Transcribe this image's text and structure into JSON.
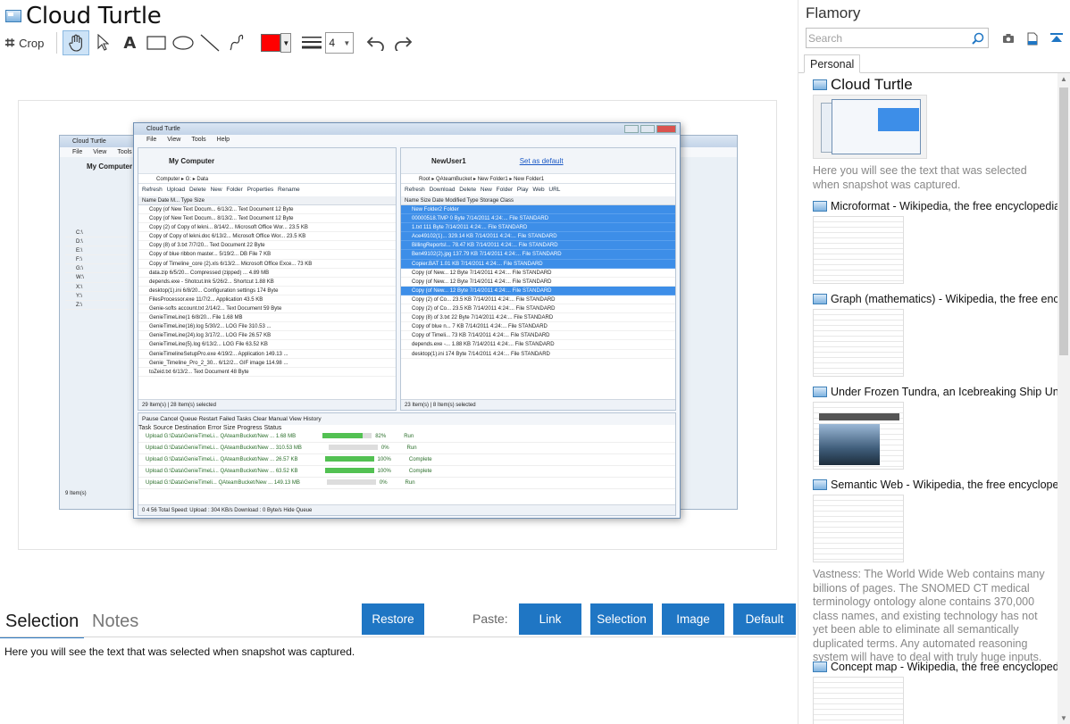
{
  "app": {
    "doc_title": "Cloud Turtle"
  },
  "toolbar": {
    "crop_label": "Crop",
    "color": "#ff0000",
    "line_width": "4"
  },
  "snapshot": {
    "window_title": "Cloud Turtle",
    "menu": [
      "File",
      "View",
      "Tools",
      "Help"
    ],
    "back_menu": [
      "File",
      "View",
      "Tools"
    ],
    "left_header": "My Computer",
    "left_path": "Computer ▸ G: ▸ Data",
    "left_actions": "Refresh Upload Delete New Folder Properties Rename",
    "left_cols": "Name   Date M...   Type   Size",
    "left_rows": [
      "Copy (of New Text Docum...   6/13/2...   Text Document   12 Byte",
      "Copy (of New Text Docum...   8/13/2...   Text Document   12 Byte",
      "Copy (2) of Copy of lekni...   8/14/2...   Microsoft Office Wor...   23.5 KB",
      "Copy of Copy of lekni.doc   6/13/2...   Microsoft Office Wor...   23.5 KB",
      "Copy (8) of 3.txt   7/7/20...   Text Document   22 Byte",
      "Copy of blue ribbon master...   5/19/2...   DB File   7 KB",
      "Copy of Timeline_core (2).xls   6/13/2...   Microsoft Office Exce...   73 KB",
      "data.zip   6/5/20...   Compressed (zipped) ...   4.89 MB",
      "depends.exe - Shotcut.lnk   5/26/2...   Shortcut   1.88 KB",
      "desktop(1).ini   6/8/20...   Configuration settings   174 Byte",
      "FilesProcessor.exe   11/7/2...   Application   43.5 KB",
      "Genie-softs account.txt   2/14/2...   Text Document   59 Byte",
      "GenieTimeLine(1   6/8/20...   File   1.68 MB",
      "GenieTimeLine(16).log   5/30/2...   LOG File   310.53 ...",
      "GenieTimeLine(24).log   3/17/2...   LOG File   26.57 KB",
      "GenieTimeLine(5).log   6/13/2...   LOG File   63.52 KB",
      "GenieTimelineSetupPro.exe   4/19/2...   Application   149.13 ...",
      "Genie_Timeline_Pro_2_30...   6/12/2...   GIF image   114.98 ...",
      "toZeid.txt   6/13/2...   Text Document   48 Byte"
    ],
    "left_status": "29 Item(s)  |  28 Item(s) selected",
    "right_header": "NewUser1",
    "right_setdefault": "Set as default",
    "right_path": "Root ▸ QAteamBucket ▸ New Folder1 ▸ New Folder1",
    "right_actions": "Refresh Download Delete New Folder Play Web URL",
    "right_cols": "Name   Size   Date Modified   Type   Storage Class",
    "right_rows": [
      "New Folder2                                                         Folder",
      "00000518.TMP   0 Byte   7/14/2011 4:24:...   File   STANDARD",
      "1.txt   111 Byte   7/14/2011 4:24:...   File   STANDARD",
      "Ace49102(1)...   329.14 KB   7/14/2011 4:24:...   File   STANDARD",
      "BillingReportsI...   78.47 KB   7/14/2011 4:24:...   File   STANDARD",
      "Ben49102(2).jpg   137.79 KB   7/14/2011 4:24:...   File   STANDARD",
      "Copier.BAT   1.01 KB   7/14/2011 4:24:...   File   STANDARD",
      "Copy (of New...   12 Byte   7/14/2011 4:24:...   File   STANDARD",
      "Copy (of New...   12 Byte   7/14/2011 4:24:...   File   STANDARD",
      "Copy (of New...   12 Byte   7/14/2011 4:24:...   File   STANDARD",
      "Copy (2) of Co...   23.5 KB   7/14/2011 4:24:...   File   STANDARD",
      "Copy (2) of Co...   23.5 KB   7/14/2011 4:24:...   File   STANDARD",
      "Copy (8) of 3.txt   22 Byte   7/14/2011 4:24:...   File   STANDARD",
      "Copy of blue n...   7 KB   7/14/2011 4:24:...   File   STANDARD",
      "Copy of Timeli...   73 KB   7/14/2011 4:24:...   File   STANDARD",
      "depends.exe -...   1.88 KB   7/14/2011 4:24:...   File   STANDARD",
      "desktop(1).ini   174 Byte   7/14/2011 4:24:...   File   STANDARD"
    ],
    "right_status": "23 Item(s)  |  8 Item(s) selected",
    "queue_actions": "Pause   Cancel Queue   Restart Failed Tasks   Clear   Manual        View History",
    "queue_cols": "Task      Source      Destination      Error      Size      Progress      Status",
    "queue_rows": [
      {
        "text": "Upload   G:\\Data\\GenieTimeLi...   QAteamBucket/New ...   1.68 MB",
        "pct": 82,
        "status": "Run"
      },
      {
        "text": "Upload   G:\\Data\\GenieTimeLi...   QAteamBucket/New ...   310.53 MB",
        "pct": 0,
        "status": "Run"
      },
      {
        "text": "Upload   G:\\Data\\GenieTimeLi...   QAteamBucket/New ...   26.57 KB",
        "pct": 100,
        "status": "Complete"
      },
      {
        "text": "Upload   G:\\Data\\GenieTimeLi...   QAteamBucket/New ...   63.52 KB",
        "pct": 100,
        "status": "Complete"
      },
      {
        "text": "Upload   G:\\Data\\GenieTimeli...   QAteamBucket/New ...   149.13 MB",
        "pct": 0,
        "status": "Run"
      }
    ],
    "bottom_status": "0  4  56   Total      Speed:  Upload : 304 KB/s  Download : 0 Byte/s      Hide Queue",
    "back_drives": [
      "C:\\",
      "D:\\",
      "E:\\",
      "F:\\",
      "G:\\",
      "W:\\",
      "X:\\",
      "Y:\\",
      "Z:\\"
    ],
    "back_status": "9 Item(s)"
  },
  "tabs": {
    "selection": "Selection",
    "notes": "Notes"
  },
  "buttons": {
    "restore": "Restore",
    "paste_label": "Paste:",
    "link": "Link",
    "selection": "Selection",
    "image": "Image",
    "default": "Default"
  },
  "notes_text": "Here you will see the text that was selected when snapshot was captured.",
  "flamory": {
    "title": "Flamory",
    "search_placeholder": "Search",
    "tab_personal": "Personal",
    "items": [
      {
        "title": "Cloud Turtle",
        "desc": "Here you will see the text that was selected when snapshot was captured."
      },
      {
        "title": "Microformat - Wikipedia, the free encyclopedia",
        "desc": ""
      },
      {
        "title": "Graph (mathematics) - Wikipedia, the free ency",
        "desc": ""
      },
      {
        "title": "Under Frozen Tundra, an Icebreaking Ship Unco",
        "desc": ""
      },
      {
        "title": "Semantic Web - Wikipedia, the free encycloped",
        "desc": "Vastness: The World Wide Web contains many billions of pages. The SNOMED CT medical terminology ontology alone contains 370,000 class names, and existing technology has not yet been able to eliminate all semantically duplicated terms. Any automated reasoning system will have to deal with truly huge inputs."
      },
      {
        "title": "Concept map - Wikipedia, the free encyclopedi",
        "desc": ""
      }
    ]
  }
}
